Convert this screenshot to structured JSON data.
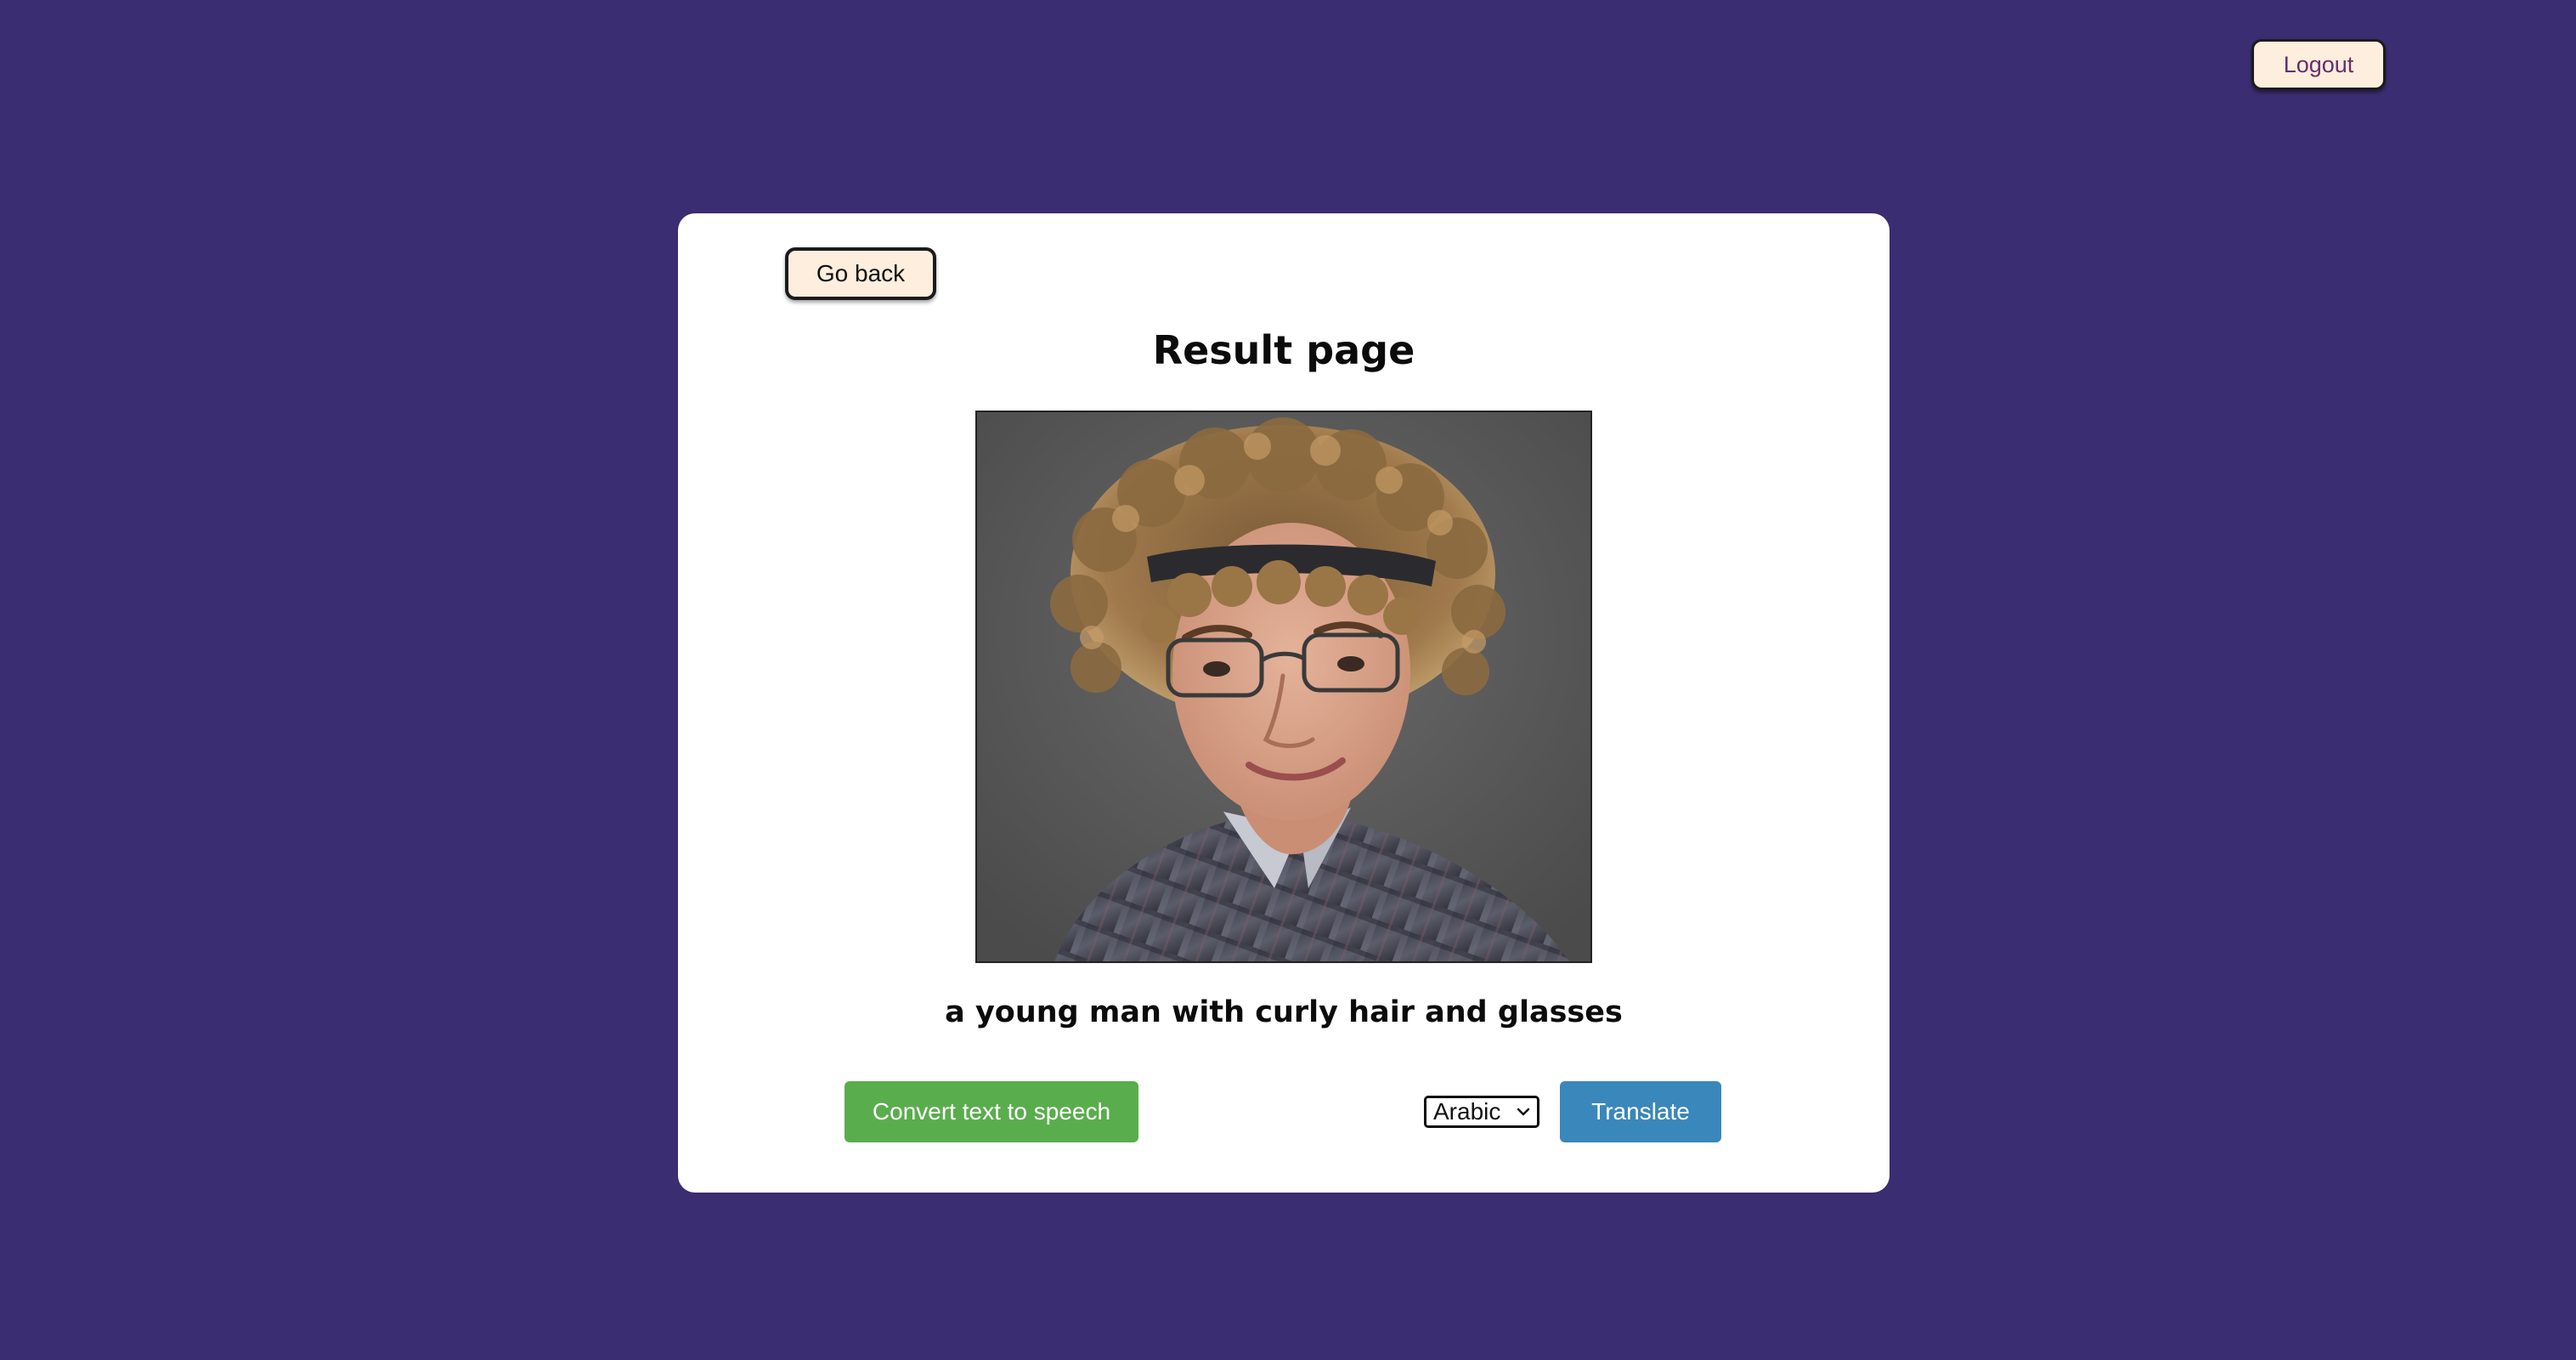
{
  "header": {
    "logout_label": "Logout"
  },
  "card": {
    "go_back_label": "Go back",
    "title": "Result page",
    "caption": "a young man with curly hair and glasses",
    "tts_label": "Convert text to speech",
    "language": {
      "selected": "Arabic"
    },
    "translate_label": "Translate"
  },
  "colors": {
    "background": "#3b2d72",
    "card": "#ffffff",
    "cream_button": "#fdeedd",
    "tts_green": "#5aad4d",
    "translate_blue": "#3a87bb",
    "logout_text": "#6a2c6a"
  },
  "icons": {
    "select_chevron": "chevron-down-icon"
  }
}
